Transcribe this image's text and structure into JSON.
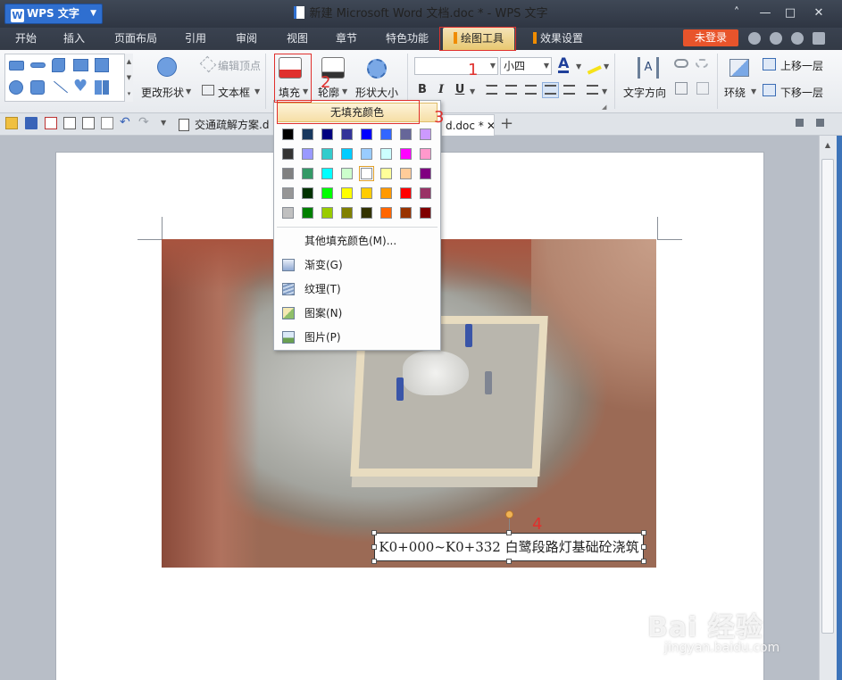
{
  "app": {
    "name": "WPS 文字",
    "logo_letter": "W",
    "window_title": "新建 Microsoft Word 文档.doc * - WPS 文字"
  },
  "window_controls": {
    "collapse": "˄",
    "minimize": "—",
    "maximize": "□",
    "close": "✕"
  },
  "menu_tabs": [
    {
      "label": "开始"
    },
    {
      "label": "插入"
    },
    {
      "label": "页面布局"
    },
    {
      "label": "引用"
    },
    {
      "label": "审阅"
    },
    {
      "label": "视图"
    },
    {
      "label": "章节"
    },
    {
      "label": "特色功能"
    },
    {
      "label": "绘图工具",
      "active": true
    },
    {
      "label": "效果设置"
    }
  ],
  "login_button": "未登录",
  "ribbon": {
    "change_shape": "更改形状",
    "edit_points": "编辑顶点",
    "text_box": "文本框",
    "fill": "填充",
    "outline": "轮廓",
    "shape_size": "形状大小",
    "font_name": "",
    "font_size": "小四",
    "text_direction": "文字方向",
    "wrap": "环绕",
    "bring_forward": "上移一层",
    "send_backward": "下移一层",
    "bold": "B",
    "italic": "I",
    "underline": "U",
    "font_color_glyph": "A"
  },
  "doc_tabs": [
    {
      "label": "交通疏解方案.d"
    },
    {
      "label": "d.doc *",
      "active": true
    }
  ],
  "new_tab": "+",
  "fill_menu": {
    "no_fill": "无填充颜色",
    "more_colors": "其他填充颜色(M)...",
    "items": [
      {
        "label": "渐变(G)"
      },
      {
        "label": "纹理(T)"
      },
      {
        "label": "图案(N)"
      },
      {
        "label": "图片(P)"
      }
    ],
    "palette": [
      [
        "#000000",
        "#17375e",
        "#000080",
        "#333399",
        "#0000ff",
        "#3366ff",
        "#666699",
        "#cc99ff"
      ],
      [
        "#333333",
        "#9999ff",
        "#33cccc",
        "#00ccff",
        "#99ccff",
        "#ccffff",
        "#ff00ff",
        "#ff99cc"
      ],
      [
        "#808080",
        "#339966",
        "#00ffff",
        "#ccffcc",
        "#ffffff",
        "#ffff99",
        "#ffcc99",
        "#800080"
      ],
      [
        "#969696",
        "#003300",
        "#00ff00",
        "#ffff00",
        "#ffcc00",
        "#ff9900",
        "#ff0000",
        "#993366"
      ],
      [
        "#c0c0c0",
        "#008000",
        "#99cc00",
        "#808000",
        "#333300",
        "#ff6600",
        "#993300",
        "#800000"
      ]
    ]
  },
  "caption_text": "K0+000~K0+332 白鹭段路灯基础砼浇筑",
  "annotations": [
    "1",
    "2",
    "3",
    "4"
  ],
  "watermark": {
    "logo": "Bai 经验",
    "url": "jingyan.baidu.com"
  },
  "colors": {
    "accent": "#2f6fd0",
    "active_tab": "#e8c870",
    "annotation": "#e0302d",
    "login": "#e8542b"
  }
}
